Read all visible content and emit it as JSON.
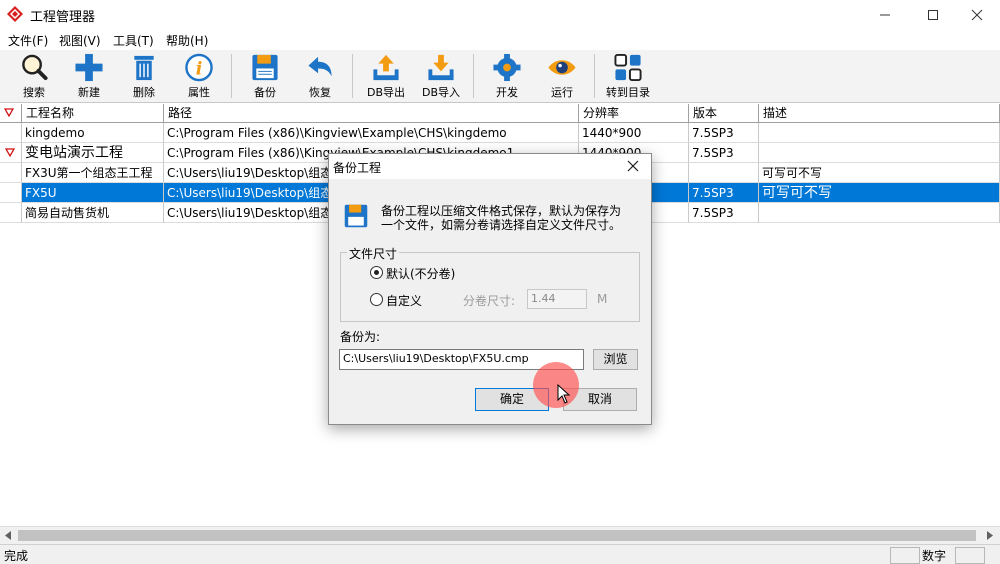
{
  "window": {
    "title": "工程管理器"
  },
  "menu": [
    "文件(F)",
    "视图(V)",
    "工具(T)",
    "帮助(H)"
  ],
  "toolbar": [
    {
      "label": "搜索",
      "icon": "search-icon"
    },
    {
      "label": "新建",
      "icon": "plus-icon"
    },
    {
      "label": "删除",
      "icon": "trash-icon"
    },
    {
      "label": "属性",
      "icon": "info-icon"
    },
    {
      "label": "备份",
      "icon": "floppy-icon"
    },
    {
      "label": "恢复",
      "icon": "undo-icon"
    },
    {
      "label": "DB导出",
      "icon": "upload-tray-icon"
    },
    {
      "label": "DB导入",
      "icon": "download-tray-icon"
    },
    {
      "label": "开发",
      "icon": "gear-icon"
    },
    {
      "label": "运行",
      "icon": "eye-icon"
    },
    {
      "label": "转到目录",
      "icon": "grid-icon"
    }
  ],
  "table": {
    "headers": [
      "工程名称",
      "路径",
      "分辨率",
      "版本",
      "描述"
    ],
    "rows": [
      {
        "name": "kingdemo",
        "path": "C:\\Program Files (x86)\\Kingview\\Example\\CHS\\kingdemo",
        "resolution": "1440*900",
        "version": "7.5SP3",
        "desc": "",
        "flag": false,
        "selected": false
      },
      {
        "name": "变电站演示工程",
        "path": "C:\\Program Files (x86)\\Kingview\\Example\\CHS\\kingdemo1",
        "resolution": "1440*900",
        "version": "7.5SP3",
        "desc": "",
        "flag": true,
        "selected": false
      },
      {
        "name": "FX3U第一个组态王工程",
        "path": "C:\\Users\\liu19\\Desktop\\组态",
        "resolution": "",
        "version": "",
        "desc": "可写可不写",
        "flag": false,
        "selected": false
      },
      {
        "name": "FX5U",
        "path": "C:\\Users\\liu19\\Desktop\\组态",
        "resolution": "",
        "version": "7.5SP3",
        "desc": "可写可不写",
        "flag": false,
        "selected": true
      },
      {
        "name": "简易自动售货机",
        "path": "C:\\Users\\liu19\\Desktop\\组态",
        "resolution": "",
        "version": "7.5SP3",
        "desc": "",
        "flag": false,
        "selected": false
      }
    ]
  },
  "dialog": {
    "title": "备份工程",
    "message_line1": "备份工程以压缩文件格式保存，默认为保存为",
    "message_line2": "一个文件，如需分卷请选择自定义文件尺寸。",
    "group_title": "文件尺寸",
    "option_default": "默认(不分卷)",
    "option_custom": "自定义",
    "split_label": "分卷尺寸:",
    "split_value": "1.44",
    "split_unit": "M",
    "save_as_label": "备份为:",
    "path_value": "C:\\Users\\liu19\\Desktop\\FX5U.cmp",
    "browse": "浏览",
    "ok": "确定",
    "cancel": "取消"
  },
  "status": {
    "left": "完成",
    "numlock": "数字"
  },
  "colors": {
    "selection": "#0078d7",
    "toolbar_icon_blue": "#1e74c6",
    "toolbar_icon_orange": "#f39c12",
    "click_highlight": "#ff4d4d"
  }
}
